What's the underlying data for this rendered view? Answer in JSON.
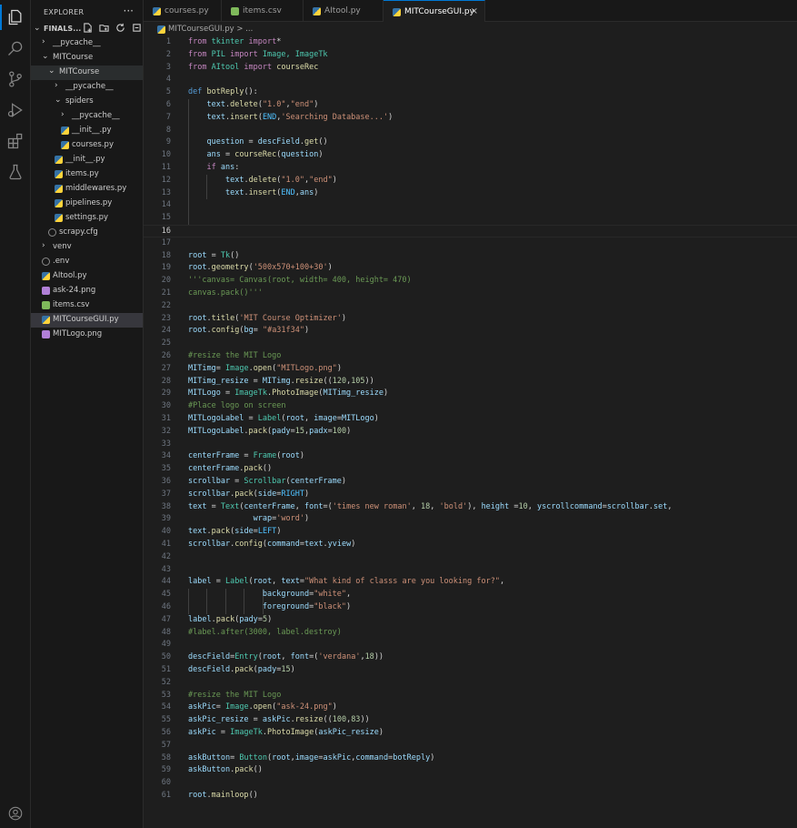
{
  "sidebar": {
    "title": "EXPLORER",
    "more": "···",
    "root_folder": "FINALS...",
    "items": [
      {
        "label": "__pycache__",
        "kind": "folder",
        "indent": 0,
        "chevron": "›"
      },
      {
        "label": "MITCourse",
        "kind": "folder",
        "indent": 0,
        "chevron": "⌄"
      },
      {
        "label": "MITCourse",
        "kind": "folder",
        "indent": 1,
        "chevron": "⌄"
      },
      {
        "label": "__pycache__",
        "kind": "folder",
        "indent": 2,
        "chevron": "›"
      },
      {
        "label": "spiders",
        "kind": "folder",
        "indent": 2,
        "chevron": "⌄"
      },
      {
        "label": "__pycache__",
        "kind": "folder",
        "indent": 3,
        "chevron": "›"
      },
      {
        "label": "__init__.py",
        "kind": "py",
        "indent": 3
      },
      {
        "label": "courses.py",
        "kind": "py",
        "indent": 3
      },
      {
        "label": "__init__.py",
        "kind": "py",
        "indent": 2
      },
      {
        "label": "items.py",
        "kind": "py",
        "indent": 2
      },
      {
        "label": "middlewares.py",
        "kind": "py",
        "indent": 2
      },
      {
        "label": "pipelines.py",
        "kind": "py",
        "indent": 2
      },
      {
        "label": "settings.py",
        "kind": "py",
        "indent": 2
      },
      {
        "label": "scrapy.cfg",
        "kind": "cfg",
        "indent": 1
      },
      {
        "label": "venv",
        "kind": "folder",
        "indent": 0,
        "chevron": "›"
      },
      {
        "label": ".env",
        "kind": "env",
        "indent": 0
      },
      {
        "label": "AItool.py",
        "kind": "py",
        "indent": 0
      },
      {
        "label": "ask-24.png",
        "kind": "png",
        "indent": 0
      },
      {
        "label": "items.csv",
        "kind": "csv",
        "indent": 0
      },
      {
        "label": "MITCourseGUI.py",
        "kind": "py",
        "indent": 0,
        "selected": true
      },
      {
        "label": "MITLogo.png",
        "kind": "png",
        "indent": 0
      }
    ]
  },
  "tabs": [
    {
      "label": "courses.py",
      "kind": "py"
    },
    {
      "label": "items.csv",
      "kind": "csv"
    },
    {
      "label": "AItool.py",
      "kind": "py"
    },
    {
      "label": "MITCourseGUI.py",
      "kind": "py",
      "active": true,
      "close": "×"
    }
  ],
  "breadcrumb": "MITCourseGUI.py > ...",
  "current_line": 16,
  "code_lines": [
    [
      [
        "from ",
        "kw"
      ],
      [
        "tkinter ",
        "cls"
      ],
      [
        "import",
        "kw"
      ],
      [
        "*",
        "op"
      ]
    ],
    [
      [
        "from ",
        "kw"
      ],
      [
        "PIL ",
        "cls"
      ],
      [
        "import ",
        "kw"
      ],
      [
        "Image, ImageTk",
        "cls"
      ]
    ],
    [
      [
        "from ",
        "kw"
      ],
      [
        "AItool ",
        "cls"
      ],
      [
        "import ",
        "kw"
      ],
      [
        "courseRec",
        "fn"
      ]
    ],
    [],
    [
      [
        "def ",
        "kwb"
      ],
      [
        "botReply",
        "fn"
      ],
      [
        "():",
        "op"
      ]
    ],
    [
      [
        "    ",
        "op"
      ],
      [
        "text",
        "var"
      ],
      [
        ".",
        "op"
      ],
      [
        "delete",
        "fn"
      ],
      [
        "(",
        "op"
      ],
      [
        "\"1.0\"",
        "str"
      ],
      [
        ",",
        "op"
      ],
      [
        "\"end\"",
        "str"
      ],
      [
        ")",
        "op"
      ]
    ],
    [
      [
        "    ",
        "op"
      ],
      [
        "text",
        "var"
      ],
      [
        ".",
        "op"
      ],
      [
        "insert",
        "fn"
      ],
      [
        "(",
        "op"
      ],
      [
        "END",
        "const"
      ],
      [
        ",",
        "op"
      ],
      [
        "'Searching Database...'",
        "str"
      ],
      [
        ")",
        "op"
      ]
    ],
    [],
    [
      [
        "    ",
        "op"
      ],
      [
        "question",
        "var"
      ],
      [
        " = ",
        "op"
      ],
      [
        "descField",
        "var"
      ],
      [
        ".",
        "op"
      ],
      [
        "get",
        "fn"
      ],
      [
        "()",
        "op"
      ]
    ],
    [
      [
        "    ",
        "op"
      ],
      [
        "ans",
        "var"
      ],
      [
        " = ",
        "op"
      ],
      [
        "courseRec",
        "fn"
      ],
      [
        "(",
        "op"
      ],
      [
        "question",
        "var"
      ],
      [
        ")",
        "op"
      ]
    ],
    [
      [
        "    ",
        "op"
      ],
      [
        "if ",
        "kw"
      ],
      [
        "ans",
        "var"
      ],
      [
        ":",
        "op"
      ]
    ],
    [
      [
        "        ",
        "op"
      ],
      [
        "text",
        "var"
      ],
      [
        ".",
        "op"
      ],
      [
        "delete",
        "fn"
      ],
      [
        "(",
        "op"
      ],
      [
        "\"1.0\"",
        "str"
      ],
      [
        ",",
        "op"
      ],
      [
        "\"end\"",
        "str"
      ],
      [
        ")",
        "op"
      ]
    ],
    [
      [
        "        ",
        "op"
      ],
      [
        "text",
        "var"
      ],
      [
        ".",
        "op"
      ],
      [
        "insert",
        "fn"
      ],
      [
        "(",
        "op"
      ],
      [
        "END",
        "const"
      ],
      [
        ",",
        "op"
      ],
      [
        "ans",
        "var"
      ],
      [
        ")",
        "op"
      ]
    ],
    [],
    [],
    [],
    [],
    [
      [
        "root",
        "var"
      ],
      [
        " = ",
        "op"
      ],
      [
        "Tk",
        "cls"
      ],
      [
        "()",
        "op"
      ]
    ],
    [
      [
        "root",
        "var"
      ],
      [
        ".",
        "op"
      ],
      [
        "geometry",
        "fn"
      ],
      [
        "(",
        "op"
      ],
      [
        "'500x570+100+30'",
        "str"
      ],
      [
        ")",
        "op"
      ]
    ],
    [
      [
        "'''canvas= Canvas(root, width= 400, height= 470)",
        "com"
      ]
    ],
    [
      [
        "canvas.pack()'''",
        "com"
      ]
    ],
    [],
    [
      [
        "root",
        "var"
      ],
      [
        ".",
        "op"
      ],
      [
        "title",
        "fn"
      ],
      [
        "(",
        "op"
      ],
      [
        "'MIT Course Optimizer'",
        "str"
      ],
      [
        ")",
        "op"
      ]
    ],
    [
      [
        "root",
        "var"
      ],
      [
        ".",
        "op"
      ],
      [
        "config",
        "fn"
      ],
      [
        "(",
        "op"
      ],
      [
        "bg",
        "var"
      ],
      [
        "= ",
        "op"
      ],
      [
        "\"#a31f34\"",
        "str"
      ],
      [
        ")",
        "op"
      ]
    ],
    [],
    [
      [
        "#resize the MIT Logo",
        "com"
      ]
    ],
    [
      [
        "MITimg",
        "var"
      ],
      [
        "= ",
        "op"
      ],
      [
        "Image",
        "cls"
      ],
      [
        ".",
        "op"
      ],
      [
        "open",
        "fn"
      ],
      [
        "(",
        "op"
      ],
      [
        "\"MITLogo.png\"",
        "str"
      ],
      [
        ")",
        "op"
      ]
    ],
    [
      [
        "MITimg_resize",
        "var"
      ],
      [
        " = ",
        "op"
      ],
      [
        "MITimg",
        "var"
      ],
      [
        ".",
        "op"
      ],
      [
        "resize",
        "fn"
      ],
      [
        "((",
        "op"
      ],
      [
        "120",
        "num"
      ],
      [
        ",",
        "op"
      ],
      [
        "105",
        "num"
      ],
      [
        "))",
        "op"
      ]
    ],
    [
      [
        "MITLogo",
        "var"
      ],
      [
        " = ",
        "op"
      ],
      [
        "ImageTk",
        "cls"
      ],
      [
        ".",
        "op"
      ],
      [
        "PhotoImage",
        "fn"
      ],
      [
        "(",
        "op"
      ],
      [
        "MITimg_resize",
        "var"
      ],
      [
        ")",
        "op"
      ]
    ],
    [
      [
        "#Place logo on screen",
        "com"
      ]
    ],
    [
      [
        "MITLogoLabel",
        "var"
      ],
      [
        " = ",
        "op"
      ],
      [
        "Label",
        "cls"
      ],
      [
        "(",
        "op"
      ],
      [
        "root",
        "var"
      ],
      [
        ", ",
        "op"
      ],
      [
        "image",
        "var"
      ],
      [
        "=",
        "op"
      ],
      [
        "MITLogo",
        "var"
      ],
      [
        ")",
        "op"
      ]
    ],
    [
      [
        "MITLogoLabel",
        "var"
      ],
      [
        ".",
        "op"
      ],
      [
        "pack",
        "fn"
      ],
      [
        "(",
        "op"
      ],
      [
        "pady",
        "var"
      ],
      [
        "=",
        "op"
      ],
      [
        "15",
        "num"
      ],
      [
        ",",
        "op"
      ],
      [
        "padx",
        "var"
      ],
      [
        "=",
        "op"
      ],
      [
        "100",
        "num"
      ],
      [
        ")",
        "op"
      ]
    ],
    [],
    [
      [
        "centerFrame",
        "var"
      ],
      [
        " = ",
        "op"
      ],
      [
        "Frame",
        "cls"
      ],
      [
        "(",
        "op"
      ],
      [
        "root",
        "var"
      ],
      [
        ")",
        "op"
      ]
    ],
    [
      [
        "centerFrame",
        "var"
      ],
      [
        ".",
        "op"
      ],
      [
        "pack",
        "fn"
      ],
      [
        "()",
        "op"
      ]
    ],
    [
      [
        "scrollbar",
        "var"
      ],
      [
        " = ",
        "op"
      ],
      [
        "Scrollbar",
        "cls"
      ],
      [
        "(",
        "op"
      ],
      [
        "centerFrame",
        "var"
      ],
      [
        ")",
        "op"
      ]
    ],
    [
      [
        "scrollbar",
        "var"
      ],
      [
        ".",
        "op"
      ],
      [
        "pack",
        "fn"
      ],
      [
        "(",
        "op"
      ],
      [
        "side",
        "var"
      ],
      [
        "=",
        "op"
      ],
      [
        "RIGHT",
        "const"
      ],
      [
        ")",
        "op"
      ]
    ],
    [
      [
        "text",
        "var"
      ],
      [
        " = ",
        "op"
      ],
      [
        "Text",
        "cls"
      ],
      [
        "(",
        "op"
      ],
      [
        "centerFrame",
        "var"
      ],
      [
        ", ",
        "op"
      ],
      [
        "font",
        "var"
      ],
      [
        "=(",
        "op"
      ],
      [
        "'times new roman'",
        "str"
      ],
      [
        ", ",
        "op"
      ],
      [
        "18",
        "num"
      ],
      [
        ", ",
        "op"
      ],
      [
        "'bold'",
        "str"
      ],
      [
        "), ",
        "op"
      ],
      [
        "height",
        "var"
      ],
      [
        " =",
        "op"
      ],
      [
        "10",
        "num"
      ],
      [
        ", ",
        "op"
      ],
      [
        "yscrollcommand",
        "var"
      ],
      [
        "=",
        "op"
      ],
      [
        "scrollbar",
        "var"
      ],
      [
        ".",
        "op"
      ],
      [
        "set",
        "var"
      ],
      [
        ",",
        "op"
      ]
    ],
    [
      [
        "              ",
        "op"
      ],
      [
        "wrap",
        "var"
      ],
      [
        "=",
        "op"
      ],
      [
        "'word'",
        "str"
      ],
      [
        ")",
        "op"
      ]
    ],
    [
      [
        "text",
        "var"
      ],
      [
        ".",
        "op"
      ],
      [
        "pack",
        "fn"
      ],
      [
        "(",
        "op"
      ],
      [
        "side",
        "var"
      ],
      [
        "=",
        "op"
      ],
      [
        "LEFT",
        "const"
      ],
      [
        ")",
        "op"
      ]
    ],
    [
      [
        "scrollbar",
        "var"
      ],
      [
        ".",
        "op"
      ],
      [
        "config",
        "fn"
      ],
      [
        "(",
        "op"
      ],
      [
        "command",
        "var"
      ],
      [
        "=",
        "op"
      ],
      [
        "text",
        "var"
      ],
      [
        ".",
        "op"
      ],
      [
        "yview",
        "var"
      ],
      [
        ")",
        "op"
      ]
    ],
    [],
    [],
    [
      [
        "label",
        "var"
      ],
      [
        " = ",
        "op"
      ],
      [
        "Label",
        "cls"
      ],
      [
        "(",
        "op"
      ],
      [
        "root",
        "var"
      ],
      [
        ", ",
        "op"
      ],
      [
        "text",
        "var"
      ],
      [
        "=",
        "op"
      ],
      [
        "\"What kind of classs are you looking for?\"",
        "str"
      ],
      [
        ",",
        "op"
      ]
    ],
    [
      [
        "                ",
        "op"
      ],
      [
        "background",
        "var"
      ],
      [
        "=",
        "op"
      ],
      [
        "\"white\"",
        "str"
      ],
      [
        ",",
        "op"
      ]
    ],
    [
      [
        "                ",
        "op"
      ],
      [
        "foreground",
        "var"
      ],
      [
        "=",
        "op"
      ],
      [
        "\"black\"",
        "str"
      ],
      [
        ")",
        "op"
      ]
    ],
    [
      [
        "label",
        "var"
      ],
      [
        ".",
        "op"
      ],
      [
        "pack",
        "fn"
      ],
      [
        "(",
        "op"
      ],
      [
        "pady",
        "var"
      ],
      [
        "=",
        "op"
      ],
      [
        "5",
        "num"
      ],
      [
        ")",
        "op"
      ]
    ],
    [
      [
        "#label.after(3000, label.destroy)",
        "com"
      ]
    ],
    [],
    [
      [
        "descField",
        "var"
      ],
      [
        "=",
        "op"
      ],
      [
        "Entry",
        "cls"
      ],
      [
        "(",
        "op"
      ],
      [
        "root",
        "var"
      ],
      [
        ", ",
        "op"
      ],
      [
        "font",
        "var"
      ],
      [
        "=(",
        "op"
      ],
      [
        "'verdana'",
        "str"
      ],
      [
        ",",
        "op"
      ],
      [
        "18",
        "num"
      ],
      [
        "))",
        "op"
      ]
    ],
    [
      [
        "descField",
        "var"
      ],
      [
        ".",
        "op"
      ],
      [
        "pack",
        "fn"
      ],
      [
        "(",
        "op"
      ],
      [
        "pady",
        "var"
      ],
      [
        "=",
        "op"
      ],
      [
        "15",
        "num"
      ],
      [
        ")",
        "op"
      ]
    ],
    [],
    [
      [
        "#resize the MIT Logo",
        "com"
      ]
    ],
    [
      [
        "askPic",
        "var"
      ],
      [
        "= ",
        "op"
      ],
      [
        "Image",
        "cls"
      ],
      [
        ".",
        "op"
      ],
      [
        "open",
        "fn"
      ],
      [
        "(",
        "op"
      ],
      [
        "\"ask-24.png\"",
        "str"
      ],
      [
        ")",
        "op"
      ]
    ],
    [
      [
        "askPic_resize",
        "var"
      ],
      [
        " = ",
        "op"
      ],
      [
        "askPic",
        "var"
      ],
      [
        ".",
        "op"
      ],
      [
        "resize",
        "fn"
      ],
      [
        "((",
        "op"
      ],
      [
        "100",
        "num"
      ],
      [
        ",",
        "op"
      ],
      [
        "83",
        "num"
      ],
      [
        "))",
        "op"
      ]
    ],
    [
      [
        "askPic",
        "var"
      ],
      [
        " = ",
        "op"
      ],
      [
        "ImageTk",
        "cls"
      ],
      [
        ".",
        "op"
      ],
      [
        "PhotoImage",
        "fn"
      ],
      [
        "(",
        "op"
      ],
      [
        "askPic_resize",
        "var"
      ],
      [
        ")",
        "op"
      ]
    ],
    [],
    [
      [
        "askButton",
        "var"
      ],
      [
        "= ",
        "op"
      ],
      [
        "Button",
        "cls"
      ],
      [
        "(",
        "op"
      ],
      [
        "root",
        "var"
      ],
      [
        ",",
        "op"
      ],
      [
        "image",
        "var"
      ],
      [
        "=",
        "op"
      ],
      [
        "askPic",
        "var"
      ],
      [
        ",",
        "op"
      ],
      [
        "command",
        "var"
      ],
      [
        "=",
        "op"
      ],
      [
        "botReply",
        "var"
      ],
      [
        ")",
        "op"
      ]
    ],
    [
      [
        "askButton",
        "var"
      ],
      [
        ".",
        "op"
      ],
      [
        "pack",
        "fn"
      ],
      [
        "()",
        "op"
      ]
    ],
    [],
    [
      [
        "root",
        "var"
      ],
      [
        ".",
        "op"
      ],
      [
        "mainloop",
        "fn"
      ],
      [
        "()",
        "op"
      ]
    ]
  ],
  "indent_guides": [
    [],
    [],
    [],
    [],
    [],
    [
      1
    ],
    [
      1
    ],
    [
      1
    ],
    [
      1
    ],
    [
      1
    ],
    [
      1
    ],
    [
      1,
      2
    ],
    [
      1,
      2
    ],
    [
      1
    ],
    [
      1
    ],
    [],
    [],
    [],
    [],
    [],
    [],
    [],
    [],
    [],
    [],
    [],
    [],
    [],
    [],
    [],
    [],
    [],
    [],
    [],
    [],
    [],
    [],
    [],
    [],
    [],
    [],
    [],
    [],
    [],
    [
      1,
      2,
      3,
      4,
      5
    ],
    [
      1,
      2,
      3,
      4,
      5
    ],
    [],
    [],
    [],
    [],
    [],
    [],
    [],
    [],
    [],
    [],
    [],
    [],
    [],
    [],
    []
  ],
  "colors": {
    "accent": "#0078d4",
    "editor_bg": "#1e1e1e",
    "sidebar_bg": "#181818"
  }
}
